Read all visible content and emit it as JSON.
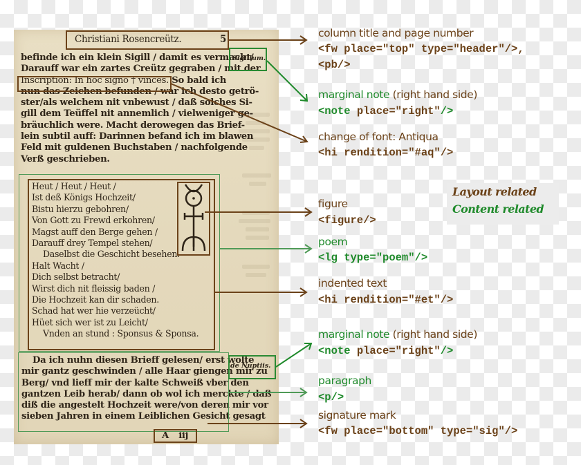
{
  "colors": {
    "layout": "#6b4219",
    "content": "#1f8a2b",
    "paper": "#e6dcc0"
  },
  "scan": {
    "header": {
      "title": "Christiani Rosencreütz.",
      "page_number": "5"
    },
    "marginal_notes": [
      "Sigillum.",
      "de Nuptiis."
    ],
    "opening_lines": [
      "befinde ich ein klein Sigill / damit es vermacht/",
      "Darauff war ein zartes Creütz gegraben / mit der",
      "Inscription: In hoc signo † vinces. So bald ich",
      "nun das Zeichen befunden / war ich desto getrö-",
      "ster/als welchem nit vnbewust / daß solches Si-",
      "gill dem Teüffel nit annemlich / vielweniger ge-",
      "bräuchlich were. Macht derowegen das Brief-",
      "lein subtil auff: Darinnen befand ich im blawen",
      "Feld mit guldenen Buchstaben / nachfolgende",
      "Verß geschrieben."
    ],
    "inscription": "Inscription: In hoc signo † vinces.",
    "inscription_after": "So bald ich",
    "poem_lines": [
      "Heut / Heut / Heut /",
      "Ist deß Königs Hochzeit/",
      "Bistu hierzu gebohren/",
      "Von Gott zu Frewd erkohren/",
      "Magst auff den Berge gehen /",
      "Darauff drey Tempel stehen/",
      "Daselbst die Geschicht besehen.",
      "Halt Wacht /",
      "Dich selbst betracht/",
      "Wirst dich nit fleissig baden /",
      "Die Hochzeit kan dir schaden.",
      "Schad hat wer hie verzeücht/",
      "Hüet sich wer ist zu Leicht/",
      "Vnden an stund : Sponsus & Sponsa."
    ],
    "paragraph_lines": [
      "Da ich nuhn diesen Brieff gelesen/ erst wolte",
      "mir gantz geschwinden / alle Haar giengen mir zu",
      "Berg/ vnd lieff mir der kalte Schweiß vber den",
      "gantzen Leib herab/ dann ob wol ich merckte / daß",
      "diß die angestelt Hochzeit were/von deren mir vor",
      "sieben Jahren in einem Leiblichen Gesicht gesagt"
    ],
    "signature": "A iij",
    "figure_icon": "monas-hieroglyphica-icon"
  },
  "annotations": [
    {
      "label": "column title and page number",
      "code_lines": [
        "<fw place=\"top\" type=\"header\"/>,",
        "<pb/>"
      ],
      "category": "layout"
    },
    {
      "label": "marginal note",
      "label_suffix": " (right hand side)",
      "code_parts": [
        "<note",
        " place=\"right\"",
        "/>"
      ],
      "category": "content"
    },
    {
      "label": "change of font: Antiqua",
      "code_lines": [
        "<hi rendition=\"#aq\"/>"
      ],
      "category": "layout"
    },
    {
      "label": "figure",
      "code_lines": [
        "<figure/>"
      ],
      "category": "layout"
    },
    {
      "label": "poem",
      "code_lines": [
        "<lg type=\"poem\"/>"
      ],
      "category": "content"
    },
    {
      "label": "indented text",
      "code_lines": [
        "<hi rendition=\"#et\"/>"
      ],
      "category": "layout"
    },
    {
      "label": "marginal note",
      "label_suffix": " (right hand side)",
      "code_parts": [
        "<note",
        " place=\"right\"",
        "/>"
      ],
      "category": "content"
    },
    {
      "label": "paragraph",
      "code_lines": [
        "<p/>"
      ],
      "category": "content"
    },
    {
      "label": "signature mark",
      "code_lines": [
        "<fw place=\"bottom\" type=\"sig\"/>"
      ],
      "category": "layout"
    }
  ],
  "legend": {
    "layout_label": "Layout related",
    "content_label": "Content related"
  }
}
